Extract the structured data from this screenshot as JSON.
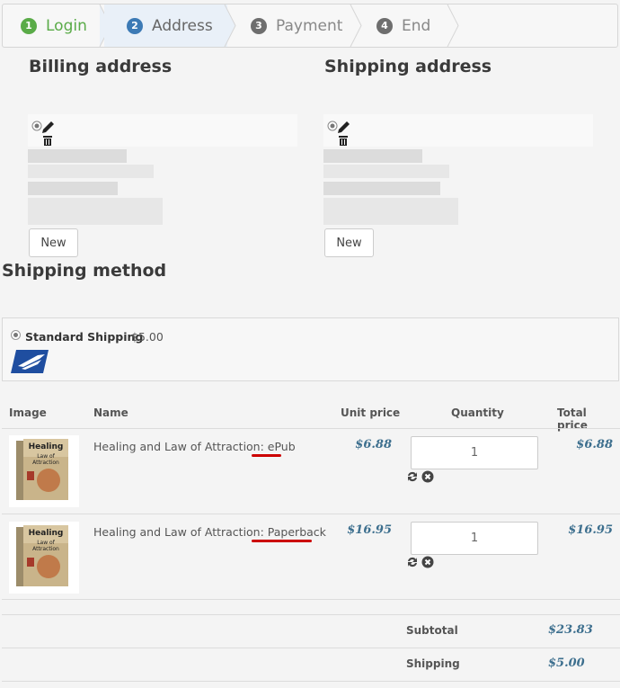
{
  "steps": [
    {
      "num": "1",
      "label": "Login"
    },
    {
      "num": "2",
      "label": "Address"
    },
    {
      "num": "3",
      "label": "Payment"
    },
    {
      "num": "4",
      "label": "End"
    }
  ],
  "billing": {
    "title": "Billing address",
    "new_label": "New"
  },
  "shipping_address": {
    "title": "Shipping address",
    "new_label": "New"
  },
  "shipping_method": {
    "title": "Shipping method",
    "option_name": "Standard Shipping",
    "option_price": "$5.00",
    "logo_icon": "usps-eagle-icon"
  },
  "cart": {
    "headers": {
      "image": "Image",
      "name": "Name",
      "unit_price": "Unit price",
      "quantity": "Quantity",
      "total_price": "Total price"
    },
    "items": [
      {
        "name_prefix": "Healing and Law of Attraction: ",
        "format": "ePub",
        "unit_price": "$6.88",
        "quantity": "1",
        "total_price": "$6.88"
      },
      {
        "name_prefix": "Healing and Law of Attraction: ",
        "format": "Paperback",
        "unit_price": "$16.95",
        "quantity": "1",
        "total_price": "$16.95"
      }
    ],
    "book_cover_text": [
      "Healing",
      "Law of",
      "Attraction"
    ],
    "subtotal_label": "Subtotal",
    "subtotal_value": "$23.83",
    "shipping_label": "Shipping",
    "shipping_value": "$5.00"
  },
  "colors": {
    "accent": "#3c7ab5",
    "done": "#5aab48",
    "price": "#3d6f8e",
    "highlight": "#cc0000"
  }
}
